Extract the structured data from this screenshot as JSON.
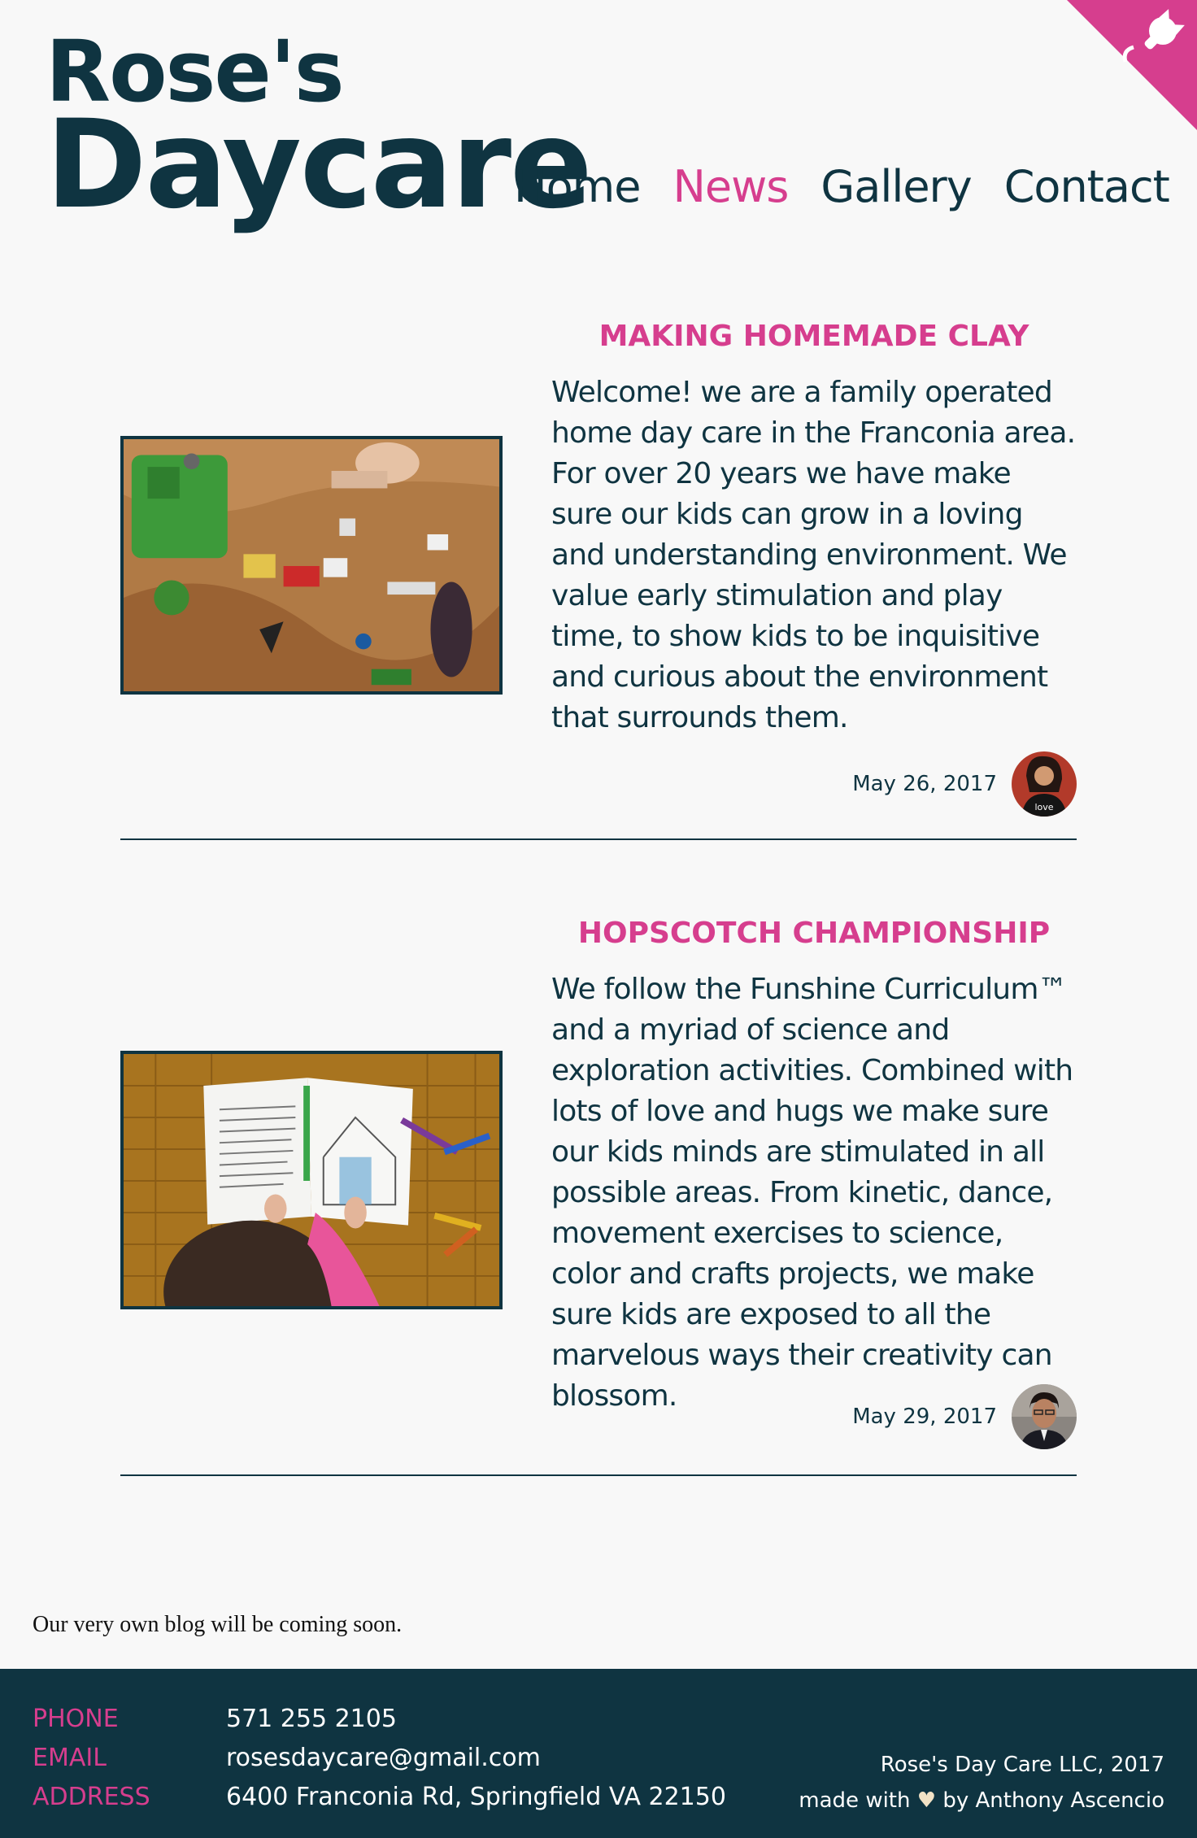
{
  "brand": {
    "line1": "Rose's",
    "line2": "Daycare"
  },
  "nav": [
    {
      "label": "Home"
    },
    {
      "label": "News"
    },
    {
      "label": "Gallery"
    },
    {
      "label": "Contact"
    }
  ],
  "posts": [
    {
      "title": "MAKING HOMEMADE CLAY",
      "text": "Welcome! we are a family operated home day care in the Franconia area. For over 20 years we have make sure our kids can grow in a loving and understanding environment. We value early stimulation and play time, to show kids to be inquisitive and curious about the environment that surrounds them.",
      "date": "May 26, 2017"
    },
    {
      "title": "HOPSCOTCH CHAMPIONSHIP",
      "text": "We follow the Funshine Curriculum™ and a myriad of science and exploration activities. Combined with lots of love and hugs we make sure our kids minds are stimulated in all possible areas. From kinetic, dance, movement exercises to science, color and crafts projects, we make sure kids are exposed to all the marvelous ways their creativity can blossom.",
      "date": "May 29, 2017"
    }
  ],
  "blog_note": "Our very own blog will be coming soon.",
  "footer": {
    "labels": {
      "phone": "PHONE",
      "email": "EMAIL",
      "address": "ADDRESS"
    },
    "phone": "571 255 2105",
    "email": "rosesdaycare@gmail.com",
    "address": "6400 Franconia Rd, Springfield VA 22150",
    "credit_line1": "Rose's Day Care LLC, 2017",
    "credit_made": "made with",
    "credit_by": "by Anthony Ascencio"
  },
  "colors": {
    "accent": "#d63e8e",
    "dark": "#0f3441",
    "background": "#f8f8f8"
  }
}
